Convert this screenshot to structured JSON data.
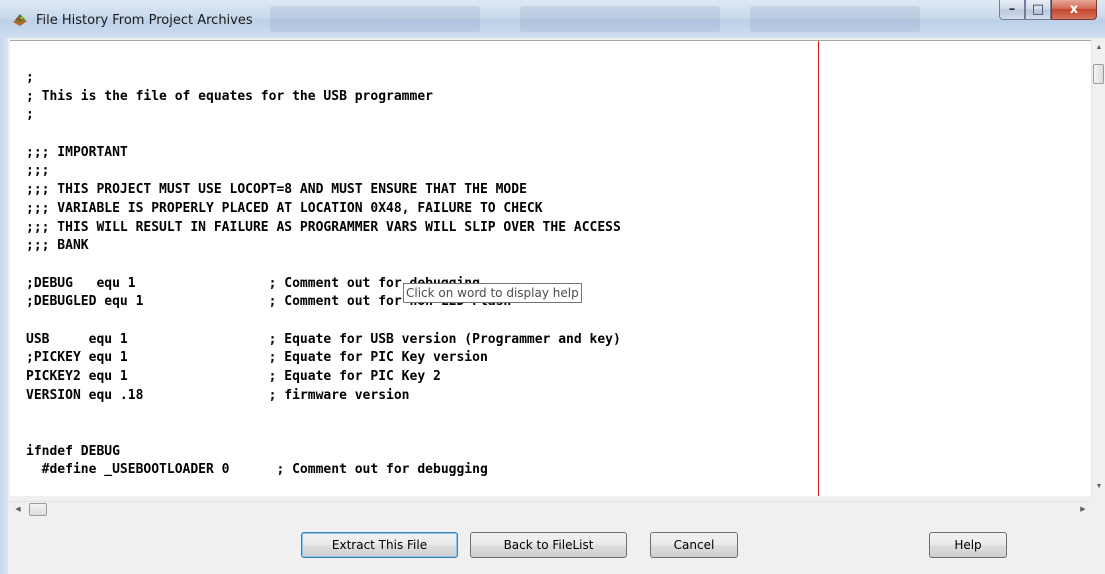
{
  "window": {
    "title": "File History From Project Archives",
    "controls": {
      "minimize": "–",
      "maximize": "□",
      "close": "x"
    }
  },
  "code_lines": [
    ";",
    "; This is the file of equates for the USB programmer",
    ";",
    "",
    ";;; IMPORTANT",
    ";;;",
    ";;; THIS PROJECT MUST USE LOCOPT=8 AND MUST ENSURE THAT THE MODE",
    ";;; VARIABLE IS PROPERLY PLACED AT LOCATION 0X48, FAILURE TO CHECK",
    ";;; THIS WILL RESULT IN FAILURE AS PROGRAMMER VARS WILL SLIP OVER THE ACCESS",
    ";;; BANK",
    "",
    ";DEBUG   equ 1                 ; Comment out for debugging",
    ";DEBUGLED equ 1                ; Comment out for non LED Flash",
    "",
    "USB     equ 1                  ; Equate for USB version (Programmer and key)",
    ";PICKEY equ 1                  ; Equate for PIC Key version",
    "PICKEY2 equ 1                  ; Equate for PIC Key 2",
    "VERSION equ .18                ; firmware version",
    "",
    "",
    "ifndef DEBUG",
    "  #define _USEBOOTLOADER 0      ; Comment out for debugging"
  ],
  "tooltip": "Click on word to display help",
  "buttons": {
    "extract": "Extract This File",
    "back": "Back to FileList",
    "cancel": "Cancel",
    "help": "Help"
  },
  "colors": {
    "margin_line": "#d31e1e",
    "code_text": "#000000",
    "background": "#ffffff"
  }
}
